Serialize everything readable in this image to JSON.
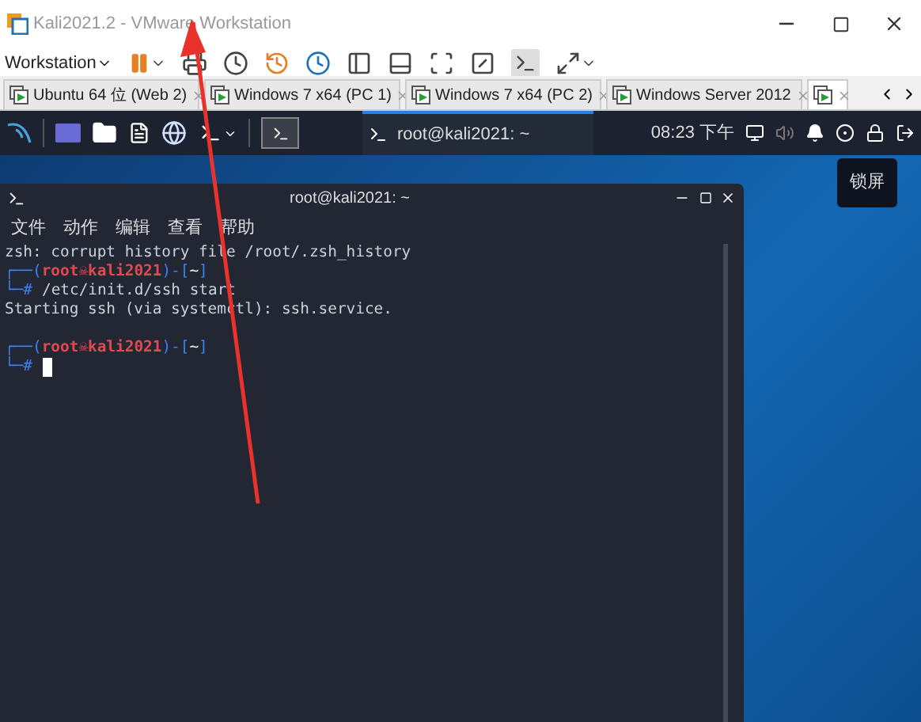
{
  "window": {
    "title": "Kali2021.2 - VMware Workstation"
  },
  "toolbar": {
    "menu": "Workstation"
  },
  "tabs": [
    {
      "label": "Ubuntu 64 位 (Web 2)",
      "selected": false
    },
    {
      "label": "Windows 7 x64 (PC 1)",
      "selected": false
    },
    {
      "label": "Windows 7 x64 (PC 2)",
      "selected": false
    },
    {
      "label": "Windows Server 2012",
      "selected": false
    },
    {
      "selected": true
    }
  ],
  "kali_panel": {
    "task_title": "root@kali2021: ~",
    "clock": "08:23 下午"
  },
  "tooltip": "锁屏",
  "terminal": {
    "title": "root@kali2021: ~",
    "menu": [
      "文件",
      "动作",
      "编辑",
      "查看",
      "帮助"
    ],
    "prompt": {
      "open": "┌──(",
      "skull": "☠",
      "mid": ")-[",
      "close": "]",
      "hash": "└─#"
    },
    "lines": [
      {
        "kind": "output",
        "text": "zsh: corrupt history file /root/.zsh_history"
      },
      {
        "kind": "prompt",
        "user": "root",
        "host": "kali2021",
        "dir": "~",
        "command": "/etc/init.d/ssh start"
      },
      {
        "kind": "output",
        "text": "Starting ssh (via systemctl): ssh.service."
      },
      {
        "kind": "blank"
      },
      {
        "kind": "prompt",
        "user": "root",
        "host": "kali2021",
        "dir": "~",
        "cursor": true
      }
    ]
  }
}
